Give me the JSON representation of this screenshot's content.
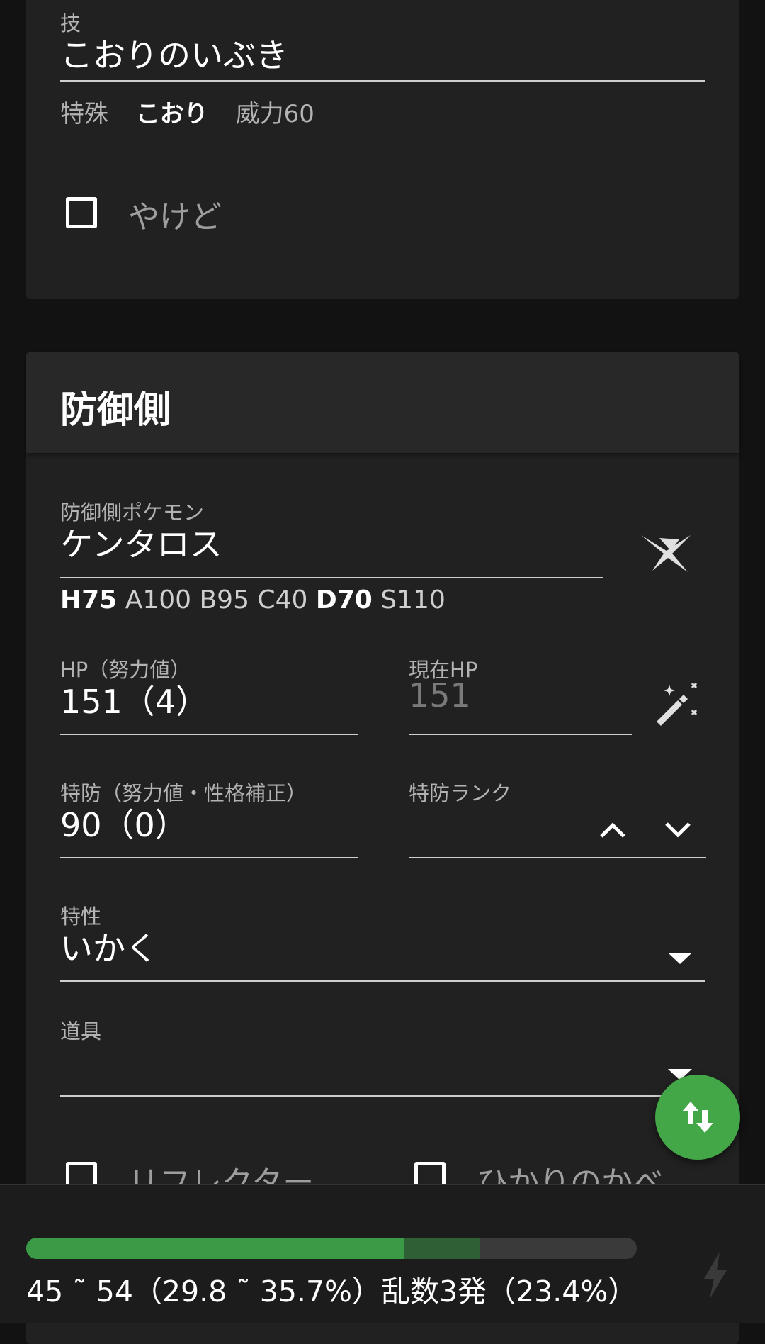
{
  "attack_card": {
    "move_label": "技",
    "move_value": "こおりのいぶき",
    "move_category": "特殊",
    "move_type": "こおり",
    "move_power": "威力60",
    "burn_label": "やけど"
  },
  "defense_card": {
    "title": "防御側",
    "pokemon_label": "防御側ポケモン",
    "pokemon_value": "ケンタロス",
    "stats": {
      "H": "H75",
      "A": "A100",
      "B": "B95",
      "C": "C40",
      "D": "D70",
      "S": "S110"
    },
    "hp_label": "HP（努力値）",
    "hp_value": "151（4）",
    "current_hp_label": "現在HP",
    "current_hp_value": "151",
    "spdef_label": "特防（努力値・性格補正）",
    "spdef_value": "90（0）",
    "spdef_rank_label": "特防ランク",
    "ability_label": "特性",
    "ability_value": "いかく",
    "item_label": "道具",
    "item_value": "",
    "reflect_label": "リフレクター",
    "light_screen_label": "ひかりのかべ"
  },
  "result": {
    "text": "45 ˜ 54（29.8 ˜ 35.7%）乱数3発（23.4%）",
    "min_percent": 29.8,
    "max_percent": 35.7
  },
  "icons": {
    "pokemon_icon": "crossed-swords-icon",
    "hp_icon": "magic-wand-icon",
    "rank_up": "chevron-up-icon",
    "rank_down": "chevron-down-icon",
    "dropdown": "triangle-down-icon",
    "fab": "swap-vertical-icon",
    "bottom": "lightning-bolt-icon"
  },
  "colors": {
    "accent": "#43a647",
    "background": "#121212",
    "card": "#212121"
  }
}
